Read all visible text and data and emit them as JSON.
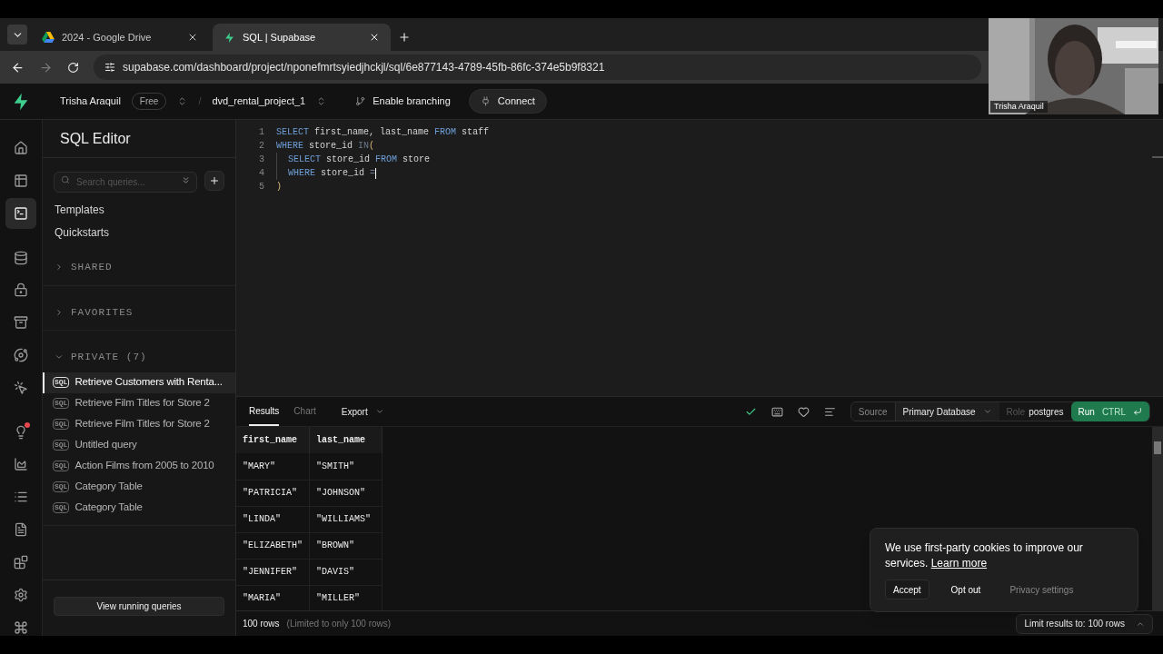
{
  "browser": {
    "tabs": [
      {
        "title": "2024 - Google Drive",
        "selected": false
      },
      {
        "title": "SQL | Supabase",
        "selected": true
      }
    ],
    "url": "supabase.com/dashboard/project/nponefmrtsyiedjhckjl/sql/6e877143-4789-45fb-86fc-374e5b9f8321"
  },
  "header": {
    "org": "Trisha Araquil",
    "plan": "Free",
    "separator": "/",
    "project": "dvd_rental_project_1",
    "branching": "Enable branching",
    "connect": "Connect"
  },
  "rail": [
    {
      "selected": false,
      "alert": false
    },
    {
      "selected": false,
      "alert": false
    },
    {
      "selected": true,
      "alert": false
    },
    {
      "selected": false,
      "alert": false
    },
    {
      "selected": false,
      "alert": false
    },
    {
      "selected": false,
      "alert": false
    },
    {
      "selected": false,
      "alert": false
    },
    {
      "selected": false,
      "alert": false
    },
    {
      "selected": false,
      "alert": true
    },
    {
      "selected": false,
      "alert": false
    },
    {
      "selected": false,
      "alert": false
    },
    {
      "selected": false,
      "alert": false
    },
    {
      "selected": false,
      "alert": false
    },
    {
      "selected": false,
      "alert": false
    },
    {
      "selected": false,
      "alert": false
    }
  ],
  "sidebar": {
    "title": "SQL Editor",
    "search_placeholder": "Search queries...",
    "links": [
      "Templates",
      "Quickstarts"
    ],
    "sections": [
      {
        "label": "SHARED",
        "expanded": false
      },
      {
        "label": "FAVORITES",
        "expanded": false
      },
      {
        "label": "PRIVATE (7)",
        "expanded": true,
        "items": [
          {
            "badge": "SQL",
            "title": "Retrieve Customers with Renta...",
            "selected": true
          },
          {
            "badge": "SQL",
            "title": "Retrieve Film Titles for Store 2",
            "selected": false
          },
          {
            "badge": "SQL",
            "title": "Retrieve Film Titles for Store 2",
            "selected": false
          },
          {
            "badge": "SQL",
            "title": "Untitled query",
            "selected": false
          },
          {
            "badge": "SQL",
            "title": "Action Films from 2005 to 2010",
            "selected": false
          },
          {
            "badge": "SQL",
            "title": "Category Table",
            "selected": false
          },
          {
            "badge": "SQL",
            "title": "Category Table",
            "selected": false
          }
        ]
      }
    ],
    "view_running": "View running queries"
  },
  "editor": {
    "lines": [
      {
        "number": "1",
        "indented": false,
        "cursor": false,
        "tokens": [
          {
            "text": "SELECT",
            "kind": "keyword"
          },
          {
            "text": " first_name, last_name ",
            "kind": "plain"
          },
          {
            "text": "FROM",
            "kind": "keyword"
          },
          {
            "text": " staff",
            "kind": "plain"
          }
        ]
      },
      {
        "number": "2",
        "indented": false,
        "cursor": false,
        "tokens": [
          {
            "text": "WHERE",
            "kind": "keyword"
          },
          {
            "text": " store_id ",
            "kind": "plain"
          },
          {
            "text": "IN",
            "kind": "dim"
          },
          {
            "text": "(",
            "kind": "bracket"
          }
        ]
      },
      {
        "number": "3",
        "indented": true,
        "cursor": false,
        "tokens": [
          {
            "text": "SELECT",
            "kind": "keyword"
          },
          {
            "text": " store_id ",
            "kind": "plain"
          },
          {
            "text": "FROM",
            "kind": "keyword"
          },
          {
            "text": " store",
            "kind": "plain"
          }
        ]
      },
      {
        "number": "4",
        "indented": true,
        "cursor": true,
        "tokens": [
          {
            "text": "WHERE",
            "kind": "keyword"
          },
          {
            "text": " store_id ",
            "kind": "plain"
          },
          {
            "text": "=",
            "kind": "dim"
          }
        ]
      },
      {
        "number": "5",
        "indented": false,
        "cursor": false,
        "tokens": [
          {
            "text": ")",
            "kind": "bracket"
          }
        ]
      }
    ]
  },
  "results": {
    "tabs": [
      {
        "label": "Results",
        "selected": true
      },
      {
        "label": "Chart",
        "selected": false
      }
    ],
    "export": "Export",
    "source_label": "Source",
    "source": "Primary Database",
    "role_label": "Role",
    "role": "postgres",
    "run": "Run",
    "run_shortcut": "CTRL",
    "columns": [
      "first_name",
      "last_name"
    ],
    "rows": [
      [
        "\"MARY\"",
        "\"SMITH\""
      ],
      [
        "\"PATRICIA\"",
        "\"JOHNSON\""
      ],
      [
        "\"LINDA\"",
        "\"WILLIAMS\""
      ],
      [
        "\"ELIZABETH\"",
        "\"BROWN\""
      ],
      [
        "\"JENNIFER\"",
        "\"DAVIS\""
      ],
      [
        "\"MARIA\"",
        "\"MILLER\""
      ]
    ],
    "row_count": "100 rows",
    "row_note": "(Limited to only 100 rows)",
    "limit": "Limit results to: 100 rows"
  },
  "cookie": {
    "text": "We use first-party cookies to improve our services.",
    "link": "Learn more",
    "buttons": [
      {
        "label": "Accept",
        "kind": "outlined"
      },
      {
        "label": "Opt out",
        "kind": "plain"
      },
      {
        "label": "Privacy settings",
        "kind": "muted"
      }
    ]
  },
  "webcam": {
    "name": "Trisha Araquil"
  }
}
